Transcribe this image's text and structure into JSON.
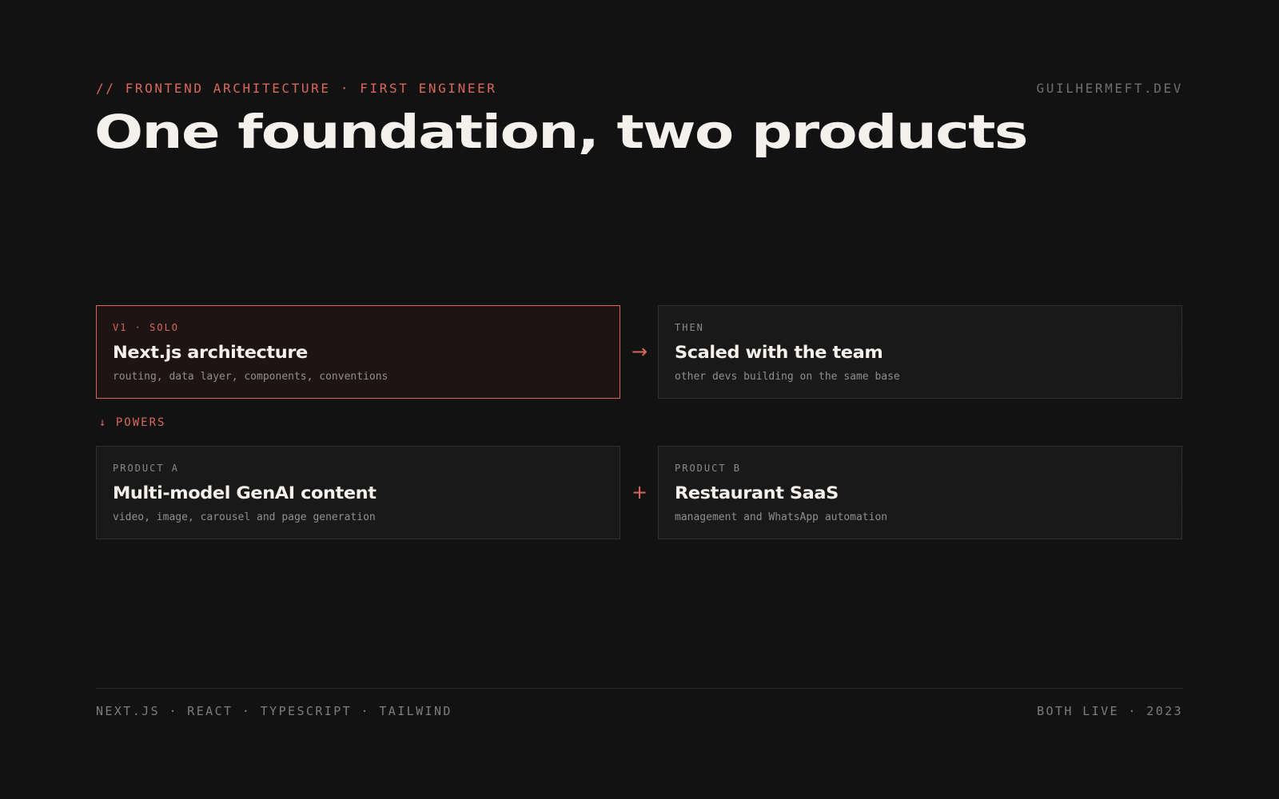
{
  "header": {
    "eyebrow": "// FRONTEND ARCHITECTURE · FIRST ENGINEER",
    "site": "GUILHERMEFT.DEV",
    "title": "One foundation, two products"
  },
  "flow": {
    "top": [
      {
        "tag": "V1 · SOLO",
        "title": "Next.js architecture",
        "desc": "routing, data layer, components, conventions",
        "highlight": true
      },
      {
        "tag": "THEN",
        "title": "Scaled with the team",
        "desc": "other devs building on the same base",
        "highlight": false
      }
    ],
    "top_connector": "→",
    "powers_label": "↓ POWERS",
    "bottom": [
      {
        "tag": "PRODUCT A",
        "title": "Multi-model GenAI content",
        "desc": "video, image, carousel and page generation"
      },
      {
        "tag": "PRODUCT B",
        "title": "Restaurant SaaS",
        "desc": "management and WhatsApp automation"
      }
    ],
    "bottom_connector": "+"
  },
  "footer": {
    "stack": "NEXT.JS · REACT · TYPESCRIPT · TAILWIND",
    "status": "BOTH LIVE · 2023"
  },
  "colors": {
    "background": "#121212",
    "accent": "#d9685a",
    "card": "#191919",
    "card_highlight": "#1e1413",
    "text": "#f4f1ec",
    "muted": "#8f8f8f"
  },
  "icons": {
    "top_connector": "arrow-right-icon",
    "powers": "arrow-down-icon",
    "bottom_connector": "plus-icon"
  }
}
